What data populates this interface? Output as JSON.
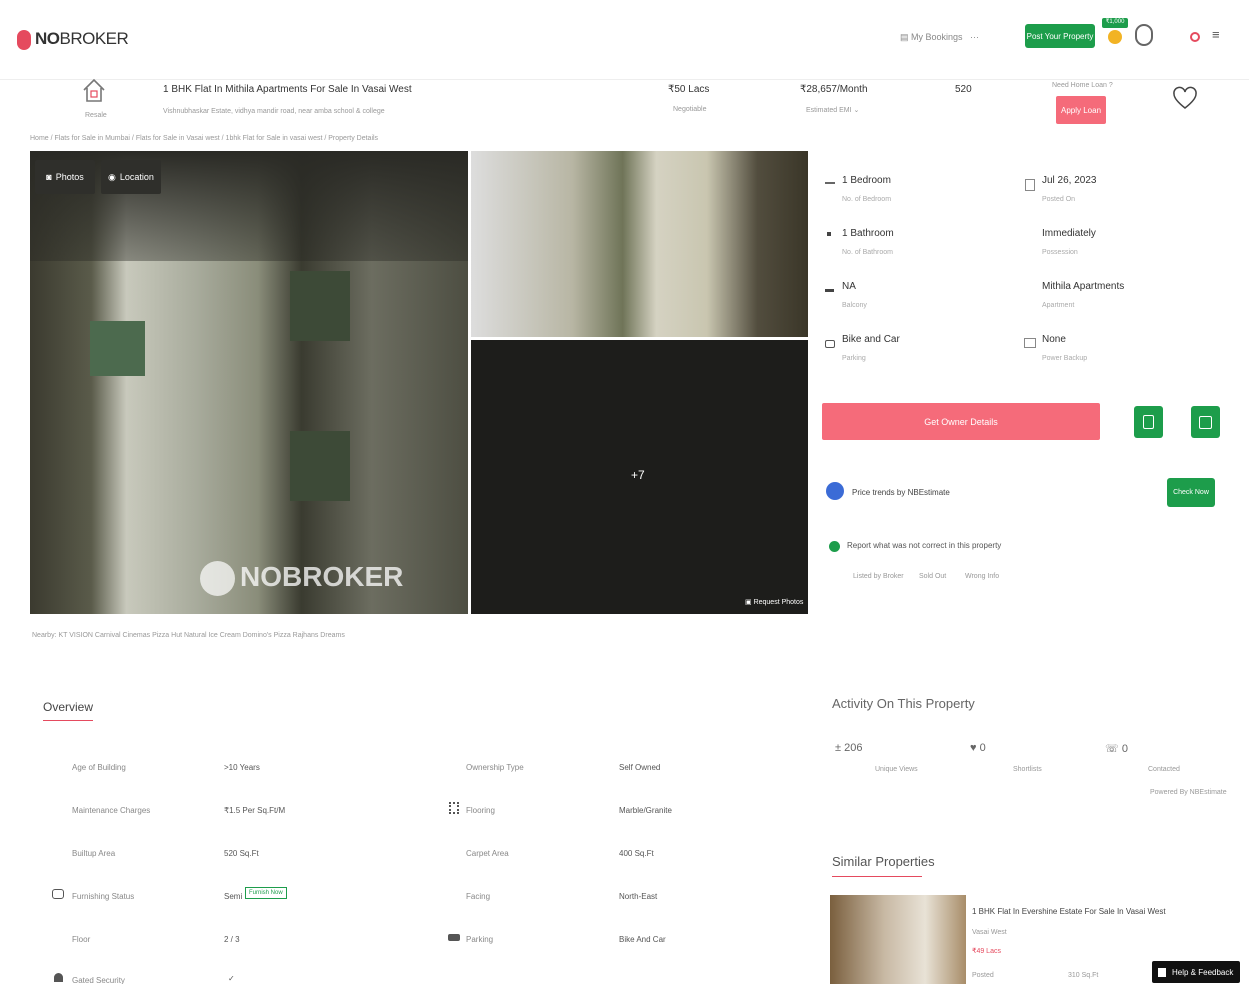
{
  "brand": {
    "bold": "NO",
    "rest": "BROKER"
  },
  "nav": {
    "bookings": "My Bookings",
    "more": "···",
    "post_property": "Post Your Property",
    "badge": "₹1,000",
    "menu": "≡"
  },
  "listing": {
    "resale_label": "Resale",
    "title": "1 BHK Flat In Mithila Apartments For Sale In Vasai West",
    "address": "Vishnubhaskar Estate, vidhya mandir road, near amba school & college",
    "price": "₹50 Lacs",
    "price_sub": "Negotiable",
    "emi": "₹28,657/Month",
    "emi_sub": "Estimated EMI ⌄",
    "area": "520",
    "loan_q": "Need Home Loan ?",
    "apply_loan": "Apply Loan"
  },
  "breadcrumb": "Home / Flats for Sale in Mumbai / Flats for Sale in Vasai west / 1bhk Flat for Sale in vasai west / Property Details",
  "gallery": {
    "photos_btn": "Photos",
    "location_btn": "Location",
    "watermark": "NOBROKER",
    "more_count": "+7",
    "request_photos": "Request Photos"
  },
  "nearby": "Nearby: KT VISION Carnival Cinemas   Pizza Hut   Natural Ice Cream   Domino's Pizza   Rajhans Dreams",
  "specs": [
    {
      "value": "1 Bedroom",
      "sub": "No. of Bedroom",
      "icon": "bed-icon"
    },
    {
      "value": "Jul 26, 2023",
      "sub": "Posted On",
      "icon": "calendar-icon"
    },
    {
      "value": "1 Bathroom",
      "sub": "No. of Bathroom",
      "icon": "bath-icon"
    },
    {
      "value": "Immediately",
      "sub": "Possession",
      "icon": "key-icon"
    },
    {
      "value": "NA",
      "sub": "Balcony",
      "icon": "balcony-icon"
    },
    {
      "value": "Mithila Apartments",
      "sub": "Apartment",
      "icon": "building-icon"
    },
    {
      "value": "Bike and Car",
      "sub": "Parking",
      "icon": "car-icon"
    },
    {
      "value": "None",
      "sub": "Power Backup",
      "icon": "power-icon"
    }
  ],
  "owner_btn": "Get Owner Details",
  "price_trends": {
    "label": "Price trends by NBEstimate",
    "btn": "Check Now"
  },
  "report": {
    "label": "Report what was not correct in this property",
    "options": [
      "Listed by Broker",
      "Sold Out",
      "Wrong Info"
    ]
  },
  "overview": {
    "heading": "Overview",
    "rows": [
      {
        "l1": "Age of Building",
        "v1": ">10 Years",
        "l2": "Ownership Type",
        "v2": "Self Owned"
      },
      {
        "l1": "Maintenance Charges",
        "v1": "₹1.5 Per Sq.Ft/M",
        "l2": "Flooring",
        "v2": "Marble/Granite"
      },
      {
        "l1": "Builtup Area",
        "v1": "520 Sq.Ft",
        "l2": "Carpet Area",
        "v2": "400 Sq.Ft"
      },
      {
        "l1": "Furnishing Status",
        "v1": "Semi",
        "v1b": "Furnish Now",
        "l2": "Facing",
        "v2": "North-East"
      },
      {
        "l1": "Floor",
        "v1": "2 / 3",
        "l2": "Parking",
        "v2": "Bike And Car"
      },
      {
        "l1": "Gated Security",
        "v1": "✓",
        "l2": "",
        "v2": ""
      }
    ]
  },
  "activity": {
    "heading": "Activity On This Property",
    "stats": [
      {
        "value": "206",
        "label": "Unique Views",
        "icon": "person-icon"
      },
      {
        "value": "0",
        "label": "Shortlists",
        "icon": "heart-icon"
      },
      {
        "value": "0",
        "label": "Contacted",
        "icon": "phone-icon"
      }
    ],
    "powered": "Powered By NBEstimate"
  },
  "similar": {
    "heading": "Similar Properties",
    "title": "1 BHK Flat In Evershine Estate For Sale In Vasai West",
    "sub1": "Vasai West",
    "price": "₹49 Lacs",
    "foot1": "Posted",
    "foot2": "310 Sq.Ft"
  },
  "help": "Help & Feedback",
  "colors": {
    "brand": "#e54a5e",
    "green": "#1d9d4b",
    "pink": "#f56b7a"
  }
}
